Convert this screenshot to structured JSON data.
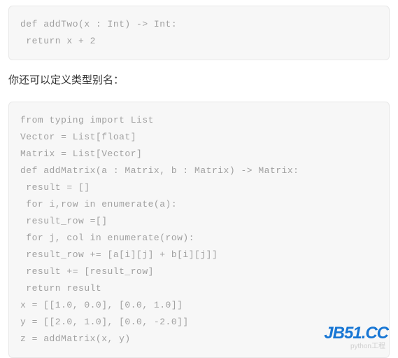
{
  "code_block_1": {
    "lines": [
      "def addTwo(x : Int) -> Int:",
      " return x + 2"
    ]
  },
  "paragraph_1": "你还可以定义类型别名：",
  "code_block_2": {
    "lines": [
      "from typing import List",
      "Vector = List[float]",
      "Matrix = List[Vector]",
      "def addMatrix(a : Matrix, b : Matrix) -> Matrix:",
      " result = []",
      " for i,row in enumerate(a):",
      " result_row =[]",
      " for j, col in enumerate(row):",
      " result_row += [a[i][j] + b[i][j]]",
      " result += [result_row]",
      " return result",
      "x = [[1.0, 0.0], [0.0, 1.0]]",
      "y = [[2.0, 1.0], [0.0, -2.0]]",
      "z = addMatrix(x, y)"
    ]
  },
  "watermark": {
    "main": "JB51.CC",
    "sub": "python工程"
  }
}
